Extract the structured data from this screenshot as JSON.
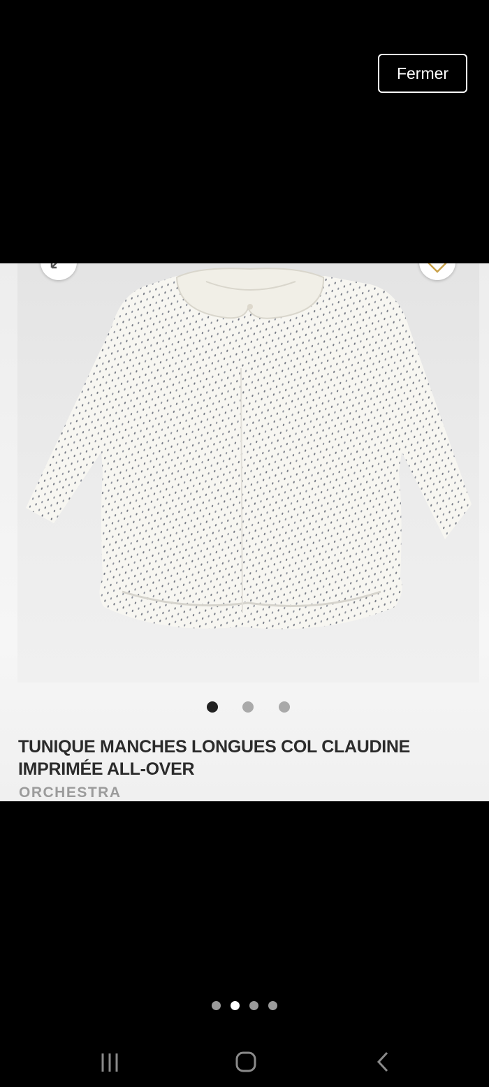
{
  "viewer": {
    "close_label": "Fermer"
  },
  "product": {
    "title": "TUNIQUE MANCHES LONGUES COL CLAUDINE IMPRIMÉE ALL-OVER",
    "brand": "ORCHESTRA",
    "image_pager": {
      "count": 3,
      "active_index": 0
    }
  },
  "gallery": {
    "count": 4,
    "active_index": 1
  },
  "icons": {
    "expand": "expand-icon",
    "favorite": "heart-icon",
    "recents": "recent-apps-icon",
    "home": "home-icon",
    "back": "back-icon"
  },
  "colors": {
    "background": "#000000",
    "card": "#f2f2f2",
    "title": "#2b2b2b",
    "brand": "#9b9b9b",
    "accent_heart": "#c9a24a"
  }
}
